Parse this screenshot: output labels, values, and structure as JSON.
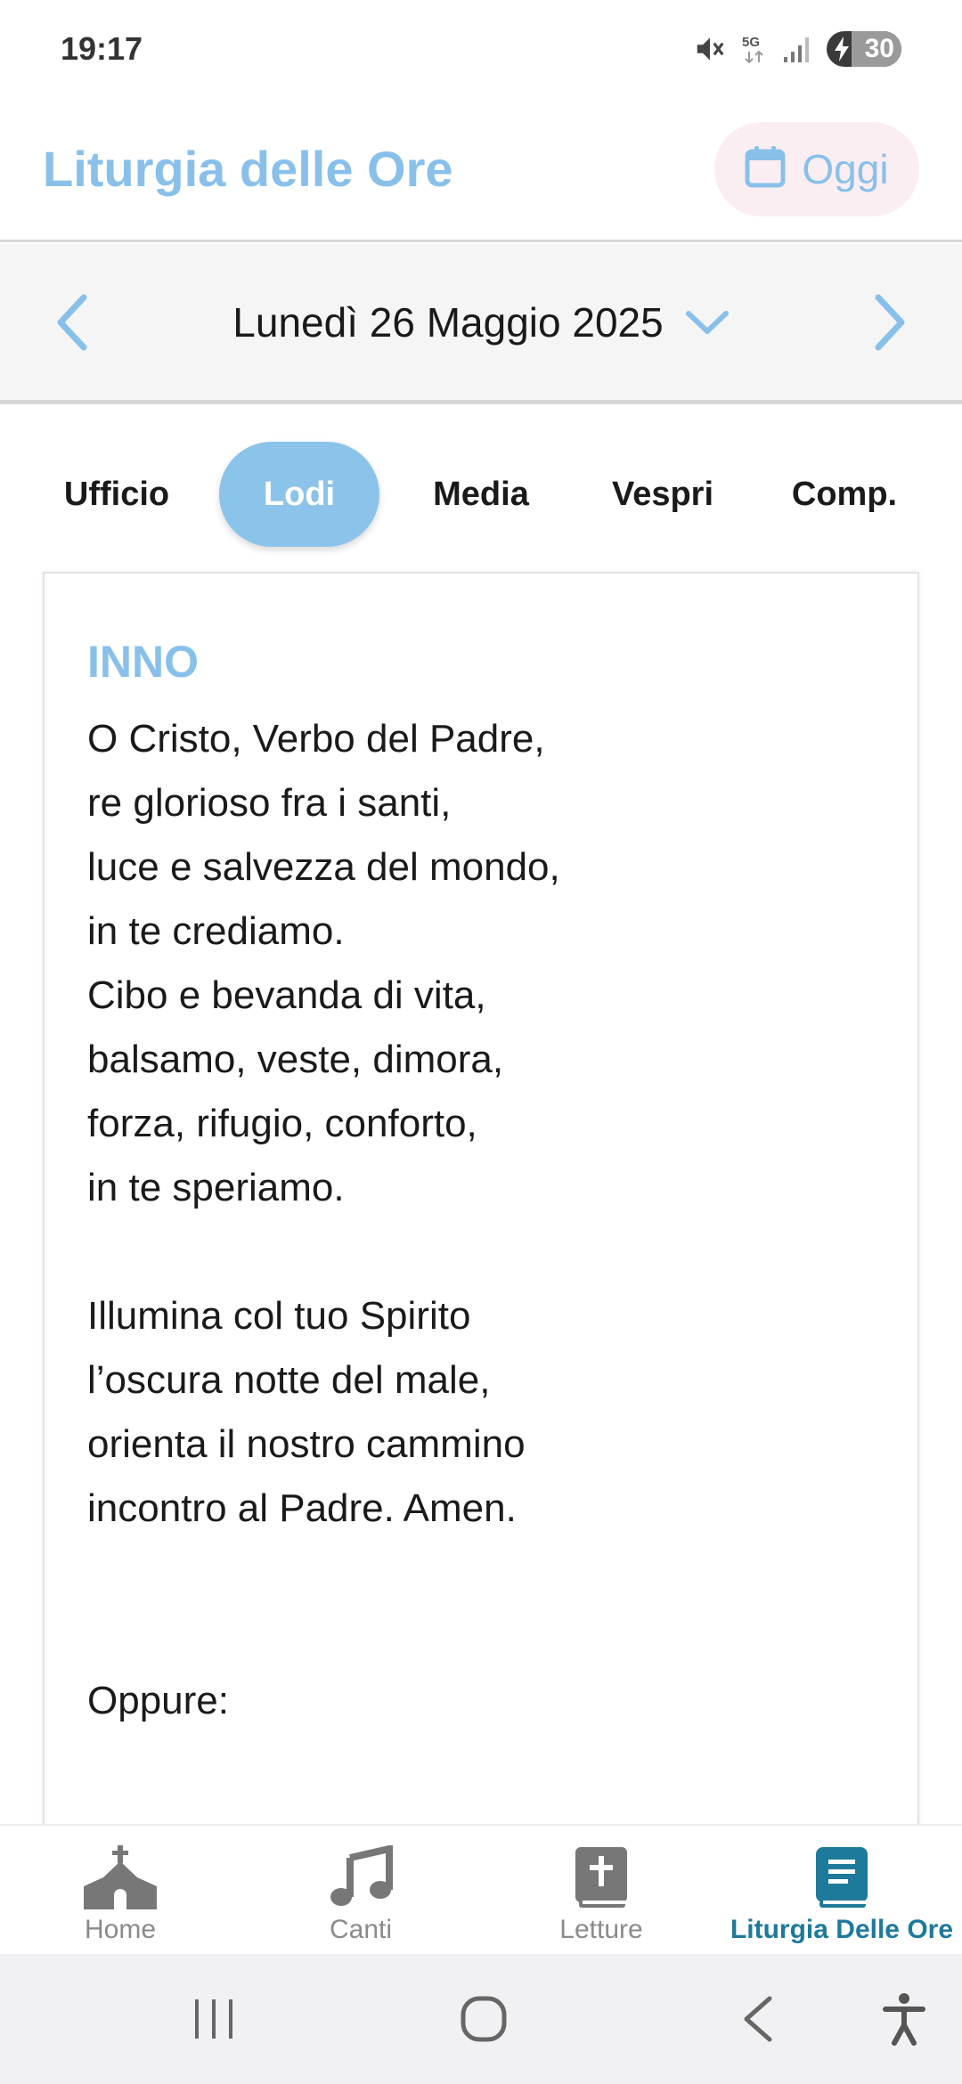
{
  "status_bar": {
    "time": "19:17",
    "battery": "30",
    "network": "5G"
  },
  "header": {
    "title": "Liturgia delle Ore",
    "today_label": "Oggi"
  },
  "date_bar": {
    "date": "Lunedì 26 Maggio 2025"
  },
  "tabs": [
    {
      "label": "Ufficio",
      "active": false
    },
    {
      "label": "Lodi",
      "active": true
    },
    {
      "label": "Media",
      "active": false
    },
    {
      "label": "Vespri",
      "active": false
    },
    {
      "label": "Comp.",
      "active": false
    }
  ],
  "content": {
    "section_title": "INNO",
    "stanza1": [
      "O Cristo, Verbo del Padre,",
      "re glorioso fra i santi,",
      "luce e salvezza del mondo,",
      "in te crediamo.",
      "Cibo e bevanda di vita,",
      "balsamo, veste, dimora,",
      "forza, rifugio, conforto,",
      "in te speriamo."
    ],
    "stanza2": [
      "Illumina col tuo Spirito",
      "l’oscura notte del male,",
      "orienta il nostro cammino",
      "incontro al Padre. Amen."
    ],
    "alternative": "Oppure:"
  },
  "bottom_nav": [
    {
      "label": "Home",
      "icon": "church-icon",
      "active": false
    },
    {
      "label": "Canti",
      "icon": "music-note-icon",
      "active": false
    },
    {
      "label": "Letture",
      "icon": "bible-icon",
      "active": false
    },
    {
      "label": "Liturgia Delle Ore",
      "icon": "book-icon",
      "active": true
    }
  ],
  "colors": {
    "accent": "#88c0ea",
    "active_tab": "#8cc3ea",
    "nav_active": "#1e7a9a",
    "today_bg": "#fbeef2"
  }
}
